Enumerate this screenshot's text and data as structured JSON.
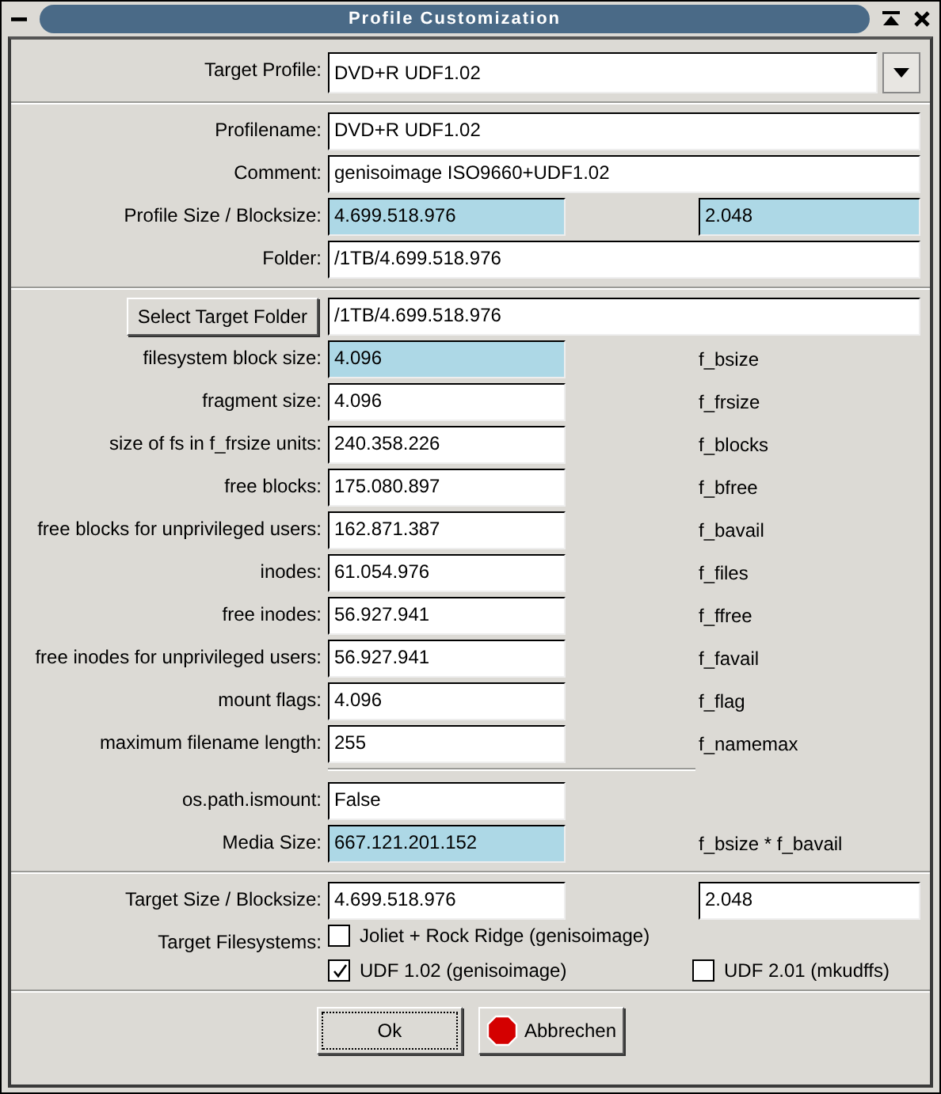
{
  "window": {
    "title": "Profile Customization"
  },
  "target_profile": {
    "label": "Target Profile:",
    "value": "DVD+R UDF1.02"
  },
  "sections": [
    {
      "rows": [
        {
          "kind": "wide",
          "label": "Profilename:",
          "value": "DVD+R UDF1.02",
          "highlighted": false
        },
        {
          "kind": "wide",
          "label": "Comment:",
          "value": "genisoimage ISO9660+UDF1.02",
          "highlighted": false
        },
        {
          "kind": "pair",
          "label": "Profile Size / Blocksize:",
          "value": "4.699.518.976",
          "value_2": "2.048",
          "highlighted": true
        },
        {
          "kind": "wide",
          "label": "Folder:",
          "value": "/1TB/4.699.518.976",
          "highlighted": false
        }
      ]
    },
    {
      "rows": [
        {
          "kind": "button",
          "label": "Select Target Folder",
          "value": "/1TB/4.699.518.976",
          "highlighted": false
        },
        {
          "kind": "stat",
          "label": "filesystem block size:",
          "value": "4.096",
          "note": "f_bsize",
          "highlighted": true
        },
        {
          "kind": "stat",
          "label": "fragment size:",
          "value": "4.096",
          "note": "f_frsize",
          "highlighted": false
        },
        {
          "kind": "stat",
          "label": "size of fs in f_frsize units:",
          "value": "240.358.226",
          "note": "f_blocks",
          "highlighted": false
        },
        {
          "kind": "stat",
          "label": "free blocks:",
          "value": "175.080.897",
          "note": "f_bfree",
          "highlighted": false
        },
        {
          "kind": "stat",
          "label": "free blocks for unprivileged users:",
          "value": "162.871.387",
          "note": "f_bavail",
          "highlighted": false
        },
        {
          "kind": "stat",
          "label": "inodes:",
          "value": "61.054.976",
          "note": "f_files",
          "highlighted": false
        },
        {
          "kind": "stat",
          "label": "free inodes:",
          "value": "56.927.941",
          "note": "f_ffree",
          "highlighted": false
        },
        {
          "kind": "stat",
          "label": "free inodes for unprivileged users:",
          "value": "56.927.941",
          "note": "f_favail",
          "highlighted": false
        },
        {
          "kind": "stat",
          "label": "mount flags:",
          "value": "4.096",
          "note": "f_flag",
          "highlighted": false
        },
        {
          "kind": "stat",
          "label": "maximum filename length:",
          "value": "255",
          "note": "f_namemax",
          "highlighted": false
        },
        {
          "kind": "rule"
        },
        {
          "kind": "stat",
          "label": "os.path.ismount:",
          "value": "False",
          "highlighted": false
        },
        {
          "kind": "stat",
          "label": "Media Size:",
          "value": "667.121.201.152",
          "note": "f_bsize * f_bavail",
          "highlighted": true
        }
      ]
    },
    {
      "rows": [
        {
          "kind": "pair",
          "label": "Target Size / Blocksize:",
          "value": "4.699.518.976",
          "value_2": "2.048",
          "highlighted": false
        },
        {
          "kind": "checks",
          "label": "Target Filesystems:",
          "options": [
            {
              "label": "Joliet + Rock Ridge (genisoimage)",
              "checked": false
            },
            {
              "label": "UDF 1.02 (genisoimage)",
              "checked": true
            },
            {
              "label": "UDF 2.01 (mkudffs)",
              "checked": false
            }
          ]
        }
      ]
    }
  ],
  "buttons": [
    {
      "label": "Ok",
      "kind": "ok",
      "focused": true
    },
    {
      "label": "Abbrechen",
      "kind": "cancel",
      "focused": false
    }
  ]
}
